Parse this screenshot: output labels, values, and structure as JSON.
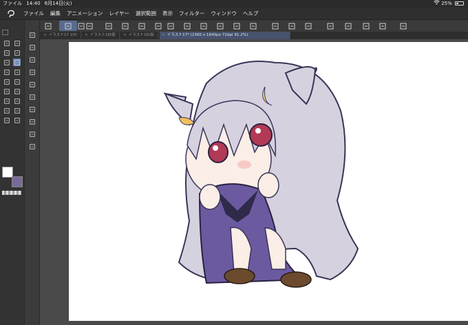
{
  "status_bar": {
    "app_menu": "ファイル",
    "time": "14:40",
    "date": "6月14日(火)",
    "battery": "25%",
    "battery_level": 0.25
  },
  "menu": {
    "items": [
      "ファイル",
      "編集",
      "アニメーション",
      "レイヤー",
      "選択範囲",
      "表示",
      "フィルター",
      "ウィンドウ",
      "ヘルプ"
    ]
  },
  "tabs": [
    {
      "label": "イラスト17 2(f)"
    },
    {
      "label": "イラスト18(仮"
    },
    {
      "label": "イラスト16(仮"
    },
    {
      "label": "イラスト17* (2360 x 1640px 72dpi 91.2%)",
      "active": true
    }
  ],
  "colors": {
    "main_color": "#ffffff",
    "sub_color": "#7a6a9a",
    "accent": "#5a6b8e"
  },
  "toolbar_icons": [
    "menu-icon",
    "pen-icon",
    "chevron-updown-icon",
    "sliders-icon",
    "new-file-icon",
    "folder-icon",
    "save-icon",
    "chevron-updown-icon",
    "undo-icon",
    "redo-icon",
    "clear-icon",
    "transform-icon",
    "fill-icon",
    "crop-icon",
    "layer-icon",
    "layer-icon",
    "layer-icon",
    "brush-icon",
    "brush-icon",
    "brush-icon",
    "device-icon",
    "edit-icon"
  ],
  "tool_icons": [
    "search-icon",
    "move-icon",
    "lasso-icon",
    "wand-icon",
    "eyedropper-icon",
    "pen-icon",
    "pencil-icon",
    "brush-icon",
    "stamp-icon",
    "eraser-icon",
    "blend-icon",
    "fill-icon",
    "gradient-icon",
    "shape-icon",
    "ruler-icon",
    "text-icon",
    "balloon-icon",
    "correct-icon"
  ]
}
